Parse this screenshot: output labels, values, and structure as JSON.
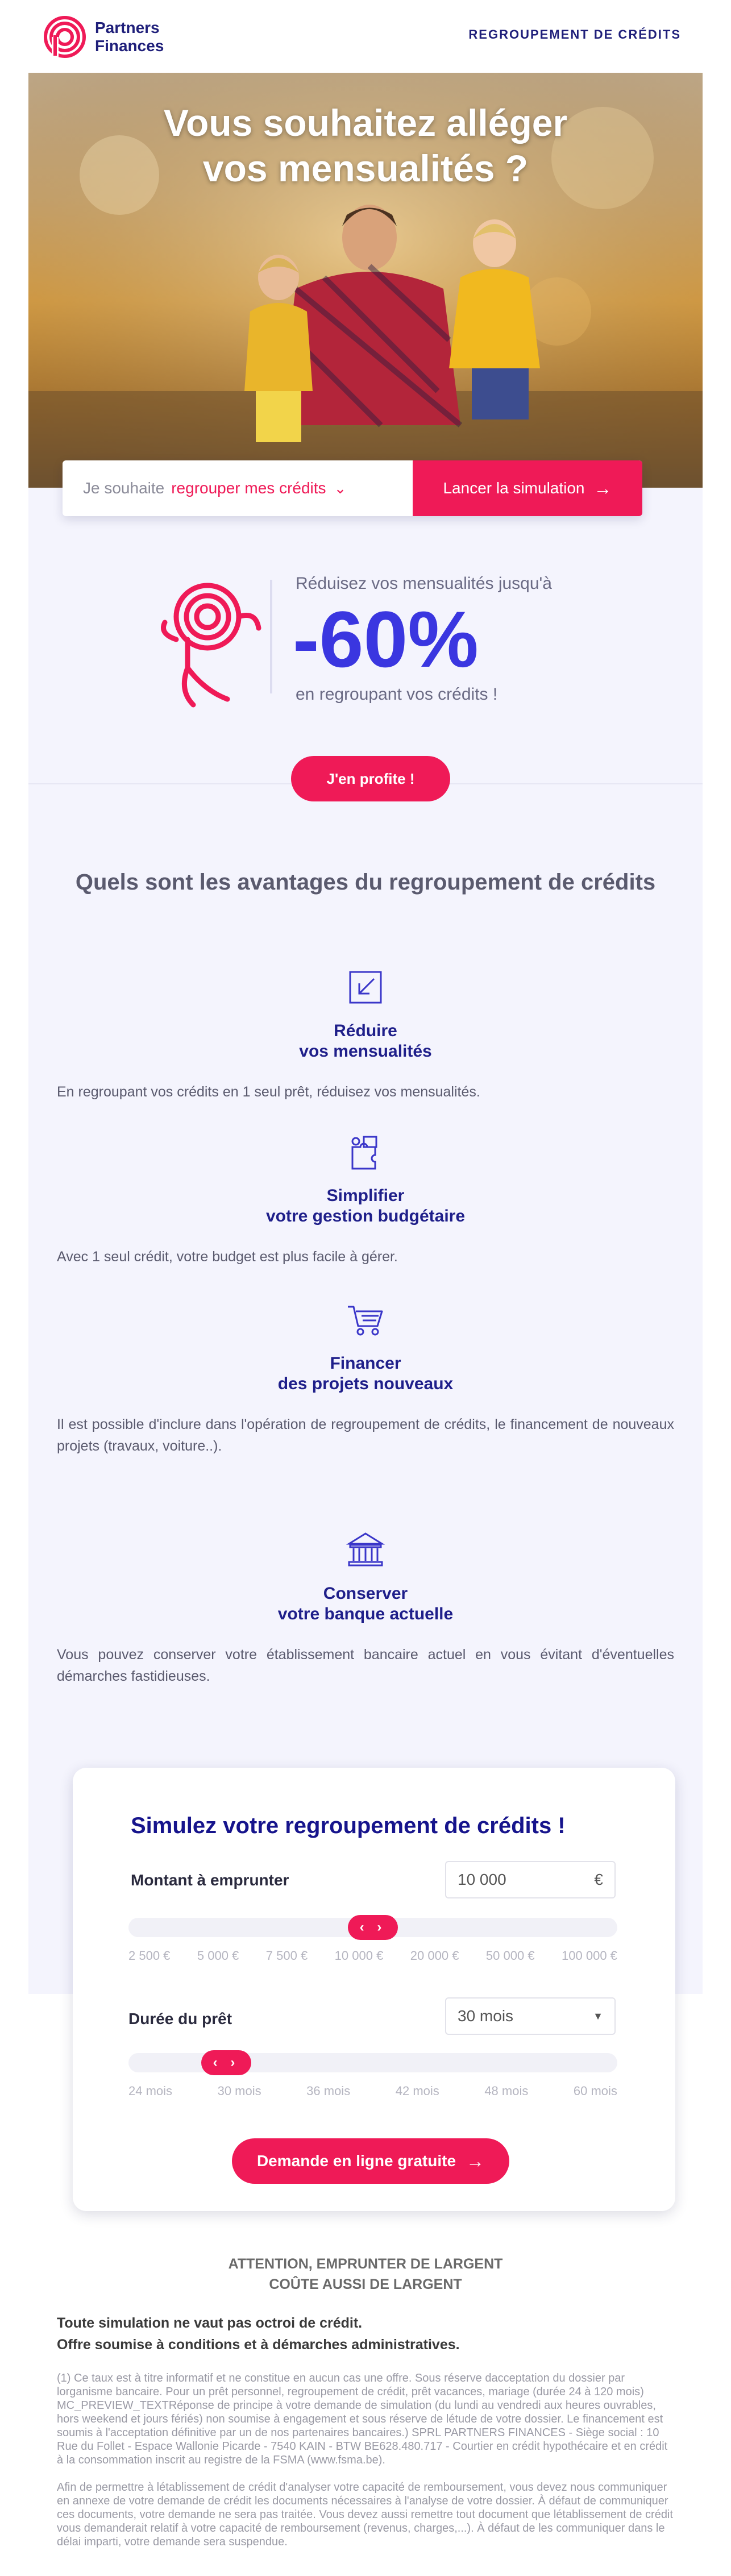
{
  "colors": {
    "brand_pink": "#ef1a57",
    "brand_navy": "#1f1f7a",
    "promo_blue": "#3a36e0",
    "band_lavender": "#f4f4fd"
  },
  "header": {
    "brand_line1": "Partners",
    "brand_line2": "Finances",
    "nav_link": "REGROUPEMENT DE CRÉDITS",
    "logo_icon": "partners-finances-logo"
  },
  "hero": {
    "title_line1": "Vous souhaitez alléger",
    "title_line2": "vos mensualités ?"
  },
  "selector": {
    "prefix": "Je souhaite",
    "value": "regrouper mes crédits",
    "chevron_icon": "chevron-down-icon",
    "button_label": "Lancer la simulation",
    "button_icon": "arrow-right-icon"
  },
  "promo": {
    "lead": "Réduisez vos mensualités jusqu'à",
    "value": "-60%",
    "tail": "en regroupant vos crédits !",
    "cta": "J'en profite !"
  },
  "benefits": {
    "title": "Quels sont les avantages du regroupement de crédits",
    "items": [
      {
        "icon": "shrink-arrow-icon",
        "title_line1": "Réduire",
        "title_line2": "vos mensualités",
        "text": "En regroupant vos crédits en 1 seul prêt, réduisez vos mensualités."
      },
      {
        "icon": "puzzle-icon",
        "title_line1": "Simplifier",
        "title_line2": "votre gestion budgétaire",
        "text": "Avec 1 seul crédit, votre budget est plus facile à gérer."
      },
      {
        "icon": "shopping-cart-icon",
        "title_line1": "Financer",
        "title_line2": "des projets nouveaux",
        "text": "Il est possible d'inclure dans l'opération de regroupement de crédits, le financement de nouveaux projets (travaux, voiture..)."
      },
      {
        "icon": "bank-icon",
        "title_line1": "Conserver",
        "title_line2": "votre banque actuelle",
        "text": "Vous pouvez conserver votre établissement bancaire actuel en vous évitant d'éventuelles démarches fastidieuses."
      }
    ]
  },
  "simulator": {
    "title": "Simulez votre regroupement de crédits !",
    "amount_label": "Montant à emprunter",
    "amount_value": "10 000",
    "amount_unit": "€",
    "amount_ticks": [
      "2 500 €",
      "5 000 €",
      "7 500 €",
      "10 000 €",
      "20 000 €",
      "50 000 €",
      "100 000 €"
    ],
    "amount_slider_fraction": 0.5,
    "duration_label": "Durée du prêt",
    "duration_value": "30 mois",
    "duration_ticks": [
      "24 mois",
      "30 mois",
      "36 mois",
      "42 mois",
      "48 mois",
      "60 mois"
    ],
    "duration_slider_fraction": 0.2,
    "thumb_glyph": "‹ ›",
    "submit_label": "Demande en ligne gratuite"
  },
  "footer": {
    "warning_line1": "ATTENTION, EMPRUNTER DE LARGENT",
    "warning_line2": "COÛTE AUSSI DE LARGENT",
    "notice_line1": "Toute simulation ne vaut pas octroi de crédit.",
    "notice_line2": "Offre soumise à conditions et à démarches administratives.",
    "legal_1": "(1) Ce taux est à titre informatif et ne constitue en aucun cas une offre. Sous réserve dacceptation du dossier par lorganisme bancaire. Pour un prêt personnel, regroupement de crédit, prêt vacances, mariage (durée 24 à 120 mois) MC_PREVIEW_TEXTRéponse de principe à votre demande de simulation (du lundi au vendredi aux heures ouvrables, hors weekend et jours fériés) non soumise à engagement et sous réserve de létude de votre dossier. Le financement est soumis à l'acceptation définitive par un de nos partenaires bancaires.) SPRL PARTNERS FINANCES - Siège social : 10 Rue du Follet - Espace Wallonie Picarde - 7540 KAIN - BTW BE628.480.717 - Courtier en crédit hypothécaire et en crédit à la consommation inscrit au registre de la FSMA (www.fsma.be).",
    "legal_2": "Afin de permettre à létablissement de crédit d'analyser votre capacité de remboursement, vous devez nous communiquer en annexe de votre demande de crédit les documents nécessaires à l'analyse de votre dossier. À défaut de communiquer ces documents, votre demande ne sera pas traitée. Vous devez aussi remettre tout document que létablissement de crédit vous demanderait relatif à votre capacité de remboursement (revenus, charges,...). À défaut de les communiquer dans le délai imparti, votre demande sera suspendue."
  }
}
